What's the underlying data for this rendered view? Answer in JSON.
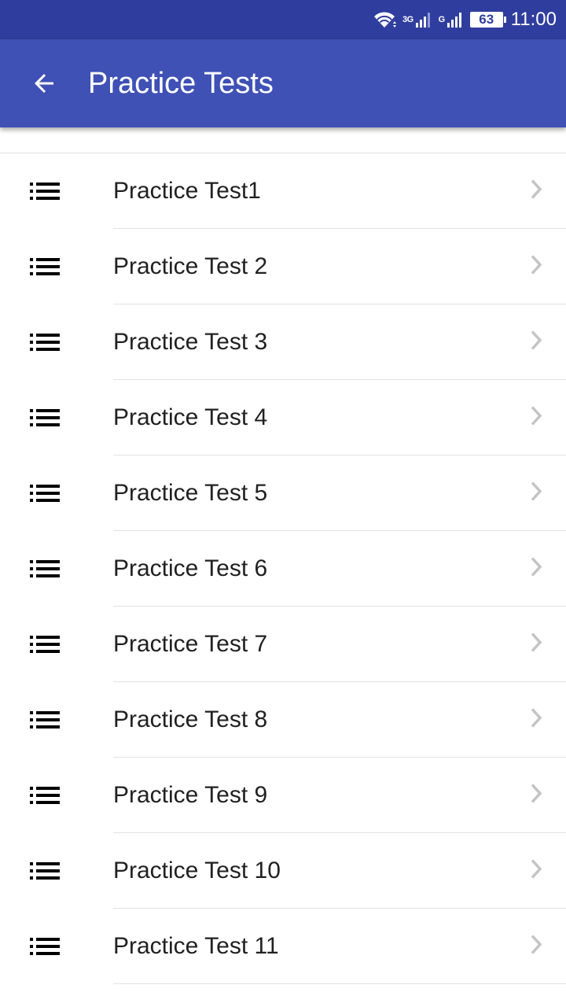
{
  "status_bar": {
    "wifi_icon": "wifi-icon",
    "network1_label": "3G",
    "network2_label": "G",
    "battery_level": "63",
    "time": "11:00",
    "background_color": "#2f3e9e"
  },
  "app_bar": {
    "title": "Practice Tests",
    "back_icon": "arrow-back-icon",
    "background_color": "#3f51b5"
  },
  "list": {
    "items": [
      {
        "label": "Practice Test1",
        "icon": "list-icon",
        "trailing_icon": "chevron-right-icon"
      },
      {
        "label": "Practice Test 2",
        "icon": "list-icon",
        "trailing_icon": "chevron-right-icon"
      },
      {
        "label": "Practice Test 3",
        "icon": "list-icon",
        "trailing_icon": "chevron-right-icon"
      },
      {
        "label": "Practice Test 4",
        "icon": "list-icon",
        "trailing_icon": "chevron-right-icon"
      },
      {
        "label": "Practice Test 5",
        "icon": "list-icon",
        "trailing_icon": "chevron-right-icon"
      },
      {
        "label": "Practice Test 6",
        "icon": "list-icon",
        "trailing_icon": "chevron-right-icon"
      },
      {
        "label": "Practice Test 7",
        "icon": "list-icon",
        "trailing_icon": "chevron-right-icon"
      },
      {
        "label": "Practice Test 8",
        "icon": "list-icon",
        "trailing_icon": "chevron-right-icon"
      },
      {
        "label": "Practice Test 9",
        "icon": "list-icon",
        "trailing_icon": "chevron-right-icon"
      },
      {
        "label": "Practice Test 10",
        "icon": "list-icon",
        "trailing_icon": "chevron-right-icon"
      },
      {
        "label": "Practice Test 11",
        "icon": "list-icon",
        "trailing_icon": "chevron-right-icon"
      }
    ]
  }
}
